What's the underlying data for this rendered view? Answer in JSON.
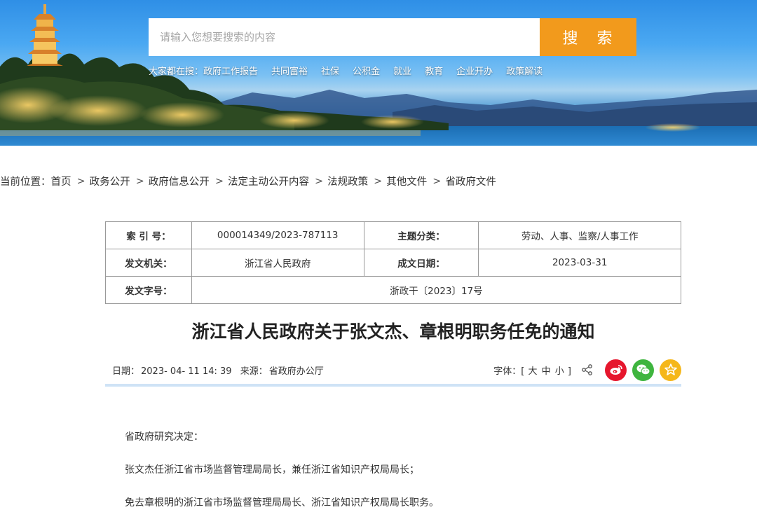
{
  "search": {
    "placeholder": "请输入您想要搜索的内容",
    "button_label": "搜 索"
  },
  "hot_searches": {
    "label": "大家都在搜：",
    "items": [
      "政府工作报告",
      "共同富裕",
      "社保",
      "公积金",
      "就业",
      "教育",
      "企业开办",
      "政策解读"
    ]
  },
  "breadcrumb": {
    "label": "当前位置：",
    "items": [
      "首页",
      "政务公开",
      "政府信息公开",
      "法定主动公开内容",
      "法规政策",
      "其他文件",
      "省政府文件"
    ],
    "separator": ">"
  },
  "meta": {
    "index_key": "索 引 号：",
    "index_value": "000014349/2023-787113",
    "category_key": "主题分类：",
    "category_value": "劳动、人事、监察/人事工作",
    "issuer_key": "发文机关：",
    "issuer_value": "浙江省人民政府",
    "date_key": "成文日期：",
    "date_value": "2023-03-31",
    "docno_key": "发文字号：",
    "docno_value": "浙政干〔2023〕17号"
  },
  "article": {
    "title": "浙江省人民政府关于张文杰、章根明职务任免的通知",
    "date_label": "日期：",
    "date_value": "2023- 04- 11 14: 39",
    "source_label": "来源：",
    "source_value": "省政府办公厅",
    "font_label": "字体：[",
    "font_large": "大",
    "font_medium": "中",
    "font_small": "小",
    "font_close": "]",
    "paragraphs": [
      "省政府研究决定：",
      "张文杰任浙江省市场监督管理局局长，兼任浙江省知识产权局局长；",
      "免去章根明的浙江省市场监督管理局局长、浙江省知识产权局局长职务。"
    ]
  },
  "icons": {
    "share": "share-icon",
    "weibo": "weibo-icon",
    "wechat": "wechat-icon",
    "favorite": "favorite-icon"
  },
  "colors": {
    "search_button": "#f29a1c",
    "weibo": "#e6162d",
    "wechat": "#3fb53f",
    "favorite": "#f5b71a",
    "info_line": "#cfe3f6"
  }
}
